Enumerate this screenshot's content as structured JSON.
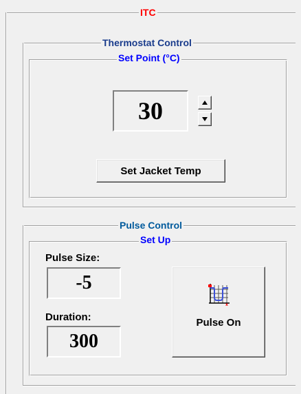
{
  "itc_group": {
    "title": "ITC"
  },
  "thermostat": {
    "title": "Thermostat Control",
    "setpoint_title": "Set Point (°C)",
    "setpoint_value": "30",
    "spin_up_icon": "arrow-up-icon",
    "spin_down_icon": "arrow-down-icon",
    "set_button_label": "Set Jacket Temp"
  },
  "pulse": {
    "title": "Pulse Control",
    "setup_title": "Set Up",
    "size_label": "Pulse Size:",
    "size_value": "-5",
    "duration_label": "Duration:",
    "duration_value": "300",
    "button_label": "Pulse On",
    "button_icon": "pulse-chart-icon"
  },
  "colors": {
    "itc_title": "#ff0000",
    "thermostat_title": "#1a3c8c",
    "setpoint_title": "#0000ff",
    "pulse_title": "#005a9c",
    "setup_title": "#0000ff",
    "pulse_icon_line": "#3a4fd8",
    "pulse_icon_marker": "#ff0000"
  }
}
